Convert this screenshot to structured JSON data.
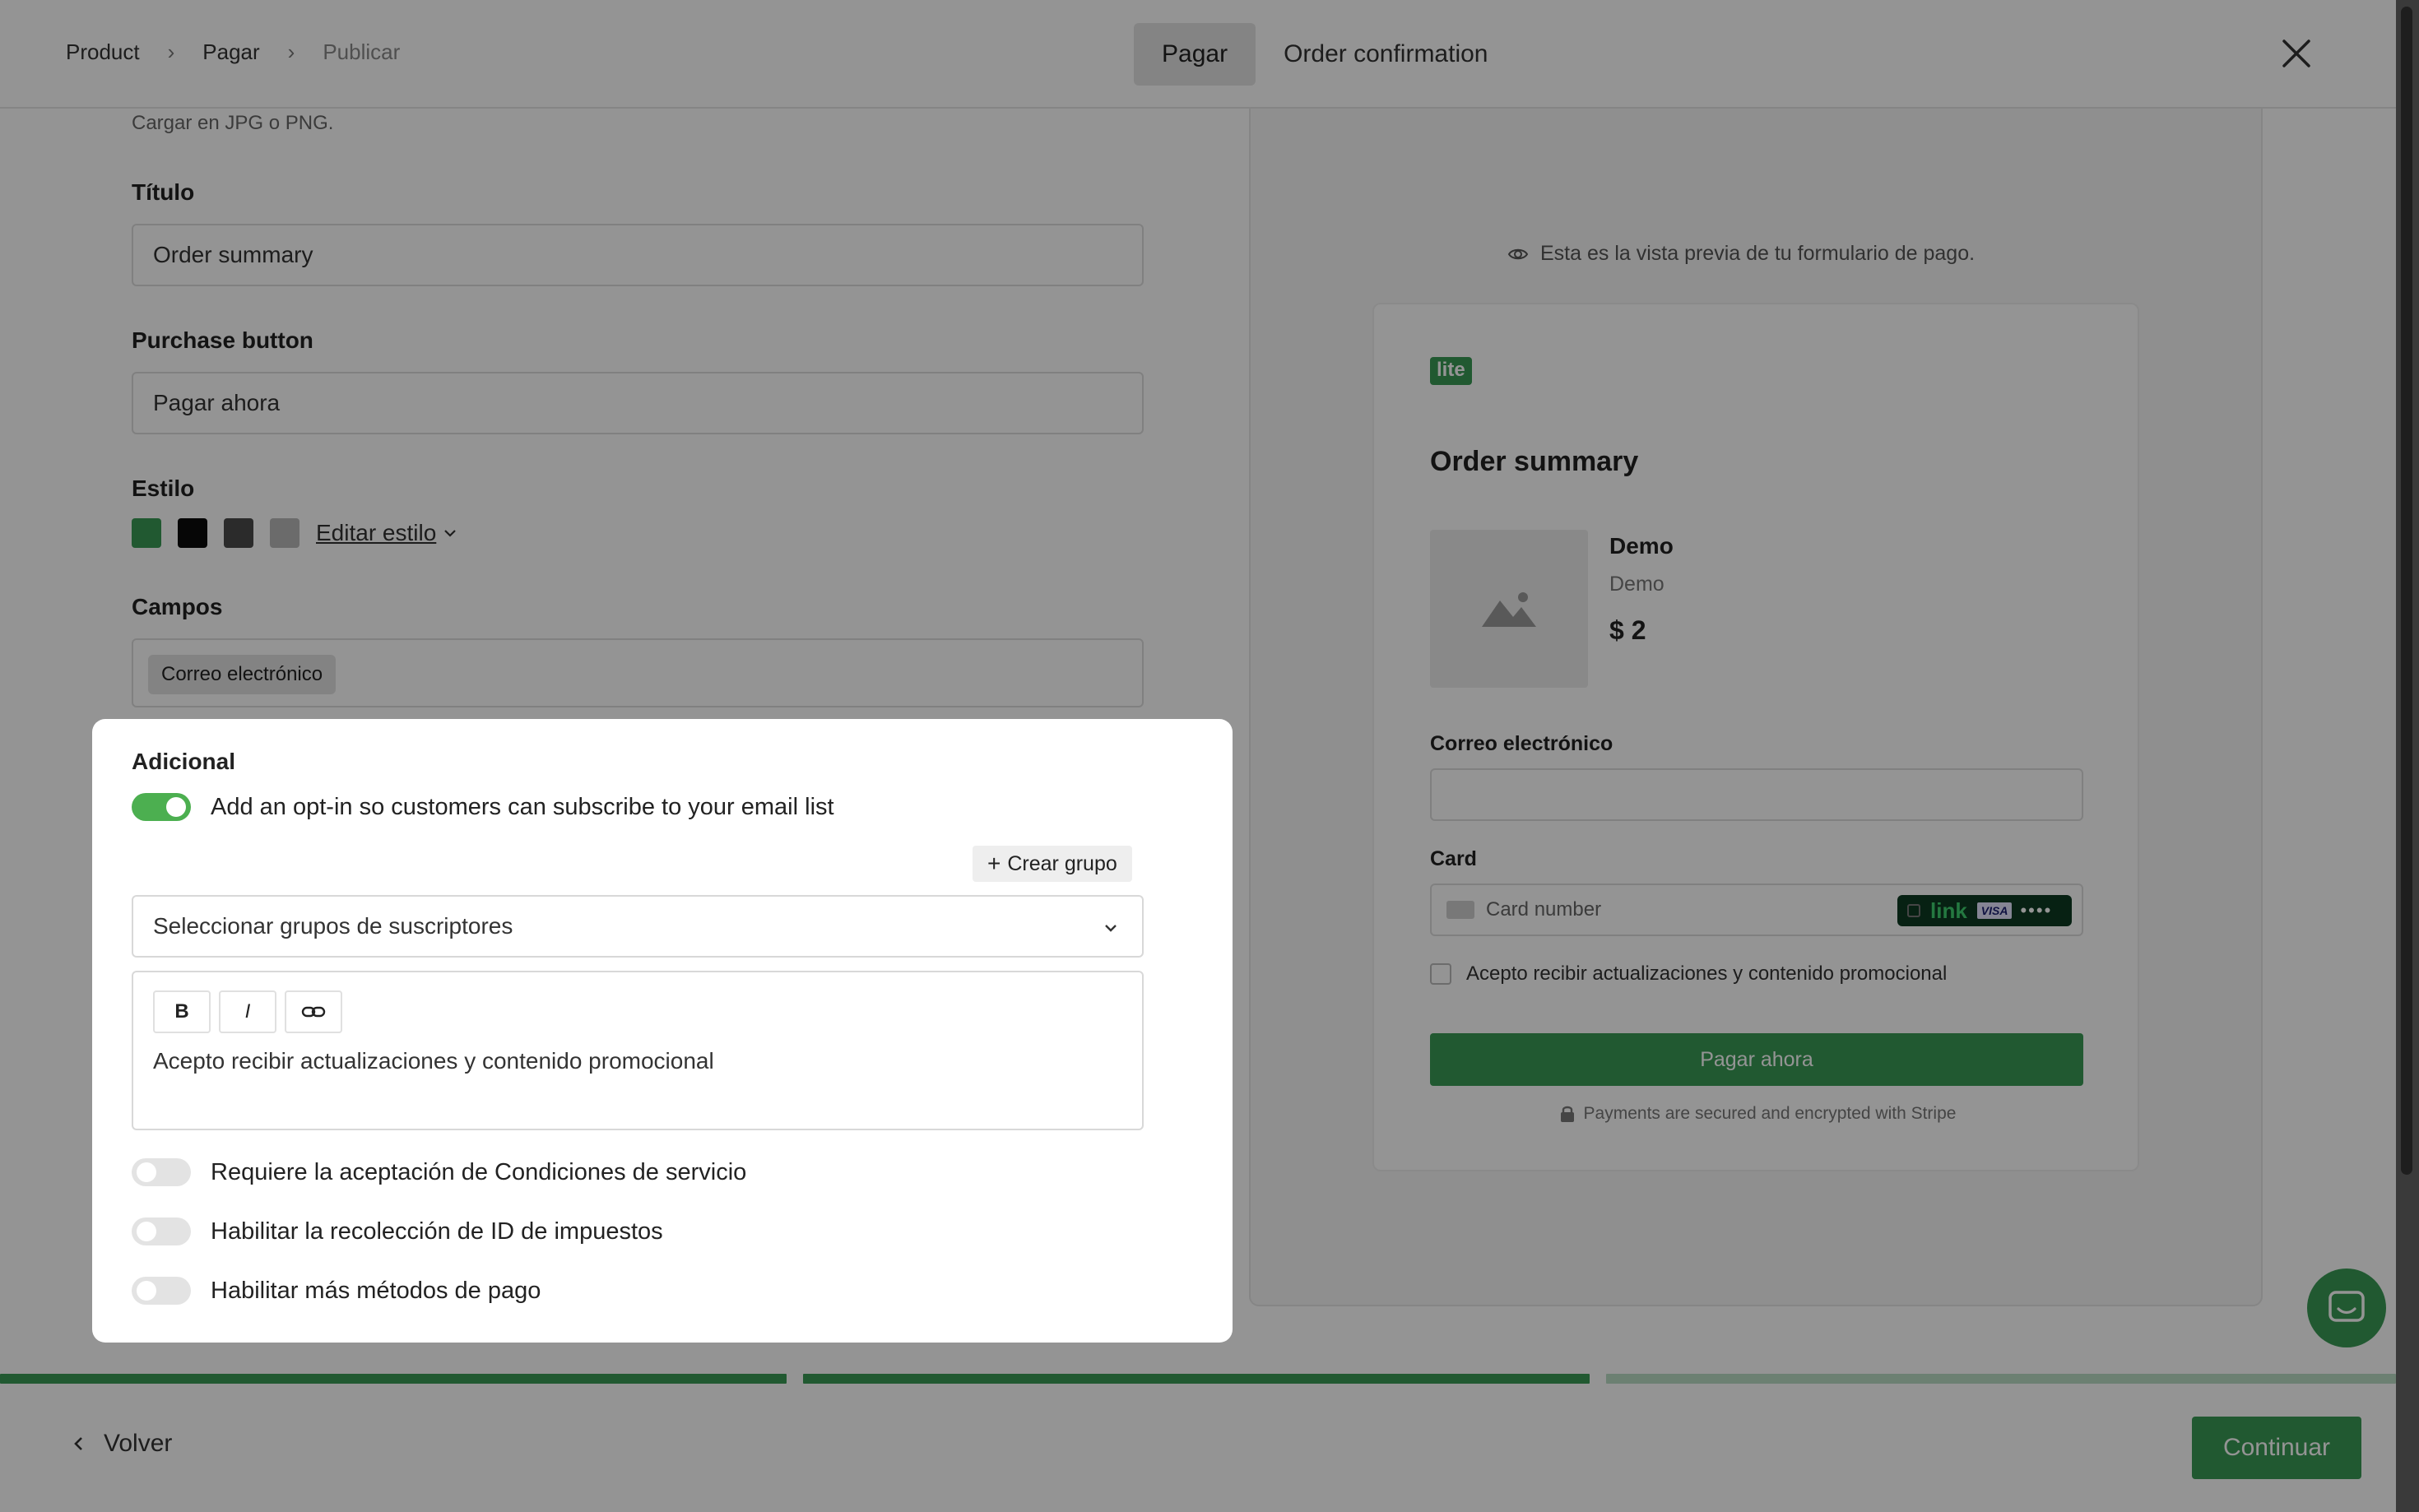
{
  "header": {
    "breadcrumbs": [
      "Product",
      "Pagar",
      "Publicar"
    ],
    "tabs": [
      {
        "label": "Pagar",
        "active": true
      },
      {
        "label": "Order confirmation",
        "active": false
      }
    ]
  },
  "form": {
    "image_hint": "Cargar en JPG o PNG.",
    "title_label": "Título",
    "title_value": "Order summary",
    "purchase_label": "Purchase button",
    "purchase_value": "Pagar ahora",
    "style_label": "Estilo",
    "style_swatches": [
      "#3a9a55",
      "#0b0b0b",
      "#4a4a4a",
      "#b9b9b9"
    ],
    "edit_style": "Editar estilo",
    "fields_label": "Campos",
    "fields_chip": "Correo electrónico"
  },
  "additional": {
    "title": "Adicional",
    "optin_label": "Add an opt-in so customers can subscribe to your email list",
    "optin_on": true,
    "create_group": "Crear grupo",
    "group_select_placeholder": "Seleccionar grupos de suscriptores",
    "editor_bold": "B",
    "editor_italic": "I",
    "editor_text": "Acepto recibir actualizaciones y contenido promocional",
    "toggles": [
      {
        "label": "Requiere la aceptación de Condiciones de servicio",
        "on": false
      },
      {
        "label": "Habilitar la recolección de ID de impuestos",
        "on": false
      },
      {
        "label": "Habilitar más métodos de pago",
        "on": false
      }
    ]
  },
  "preview": {
    "note": "Esta es la vista previa de tu formulario de pago.",
    "logo": "lite",
    "title": "Order summary",
    "product": {
      "name": "Demo",
      "description": "Demo",
      "price": "$ 2"
    },
    "email_label": "Correo electrónico",
    "card_label": "Card",
    "card_placeholder": "Card number",
    "link_text": "link",
    "visa_text": "VISA",
    "link_dots": "••••",
    "checkbox_label": "Acepto recibir actualizaciones y contenido promocional",
    "pay_button": "Pagar ahora",
    "secure_note": "Payments are secured and encrypted with Stripe"
  },
  "footer": {
    "back": "Volver",
    "continue": "Continuar",
    "progress": [
      1,
      1,
      0.35
    ]
  },
  "colors": {
    "accent": "#3a9a55",
    "toggle_on": "#4caf50",
    "overlay": "rgba(0,0,0,0.42)"
  }
}
